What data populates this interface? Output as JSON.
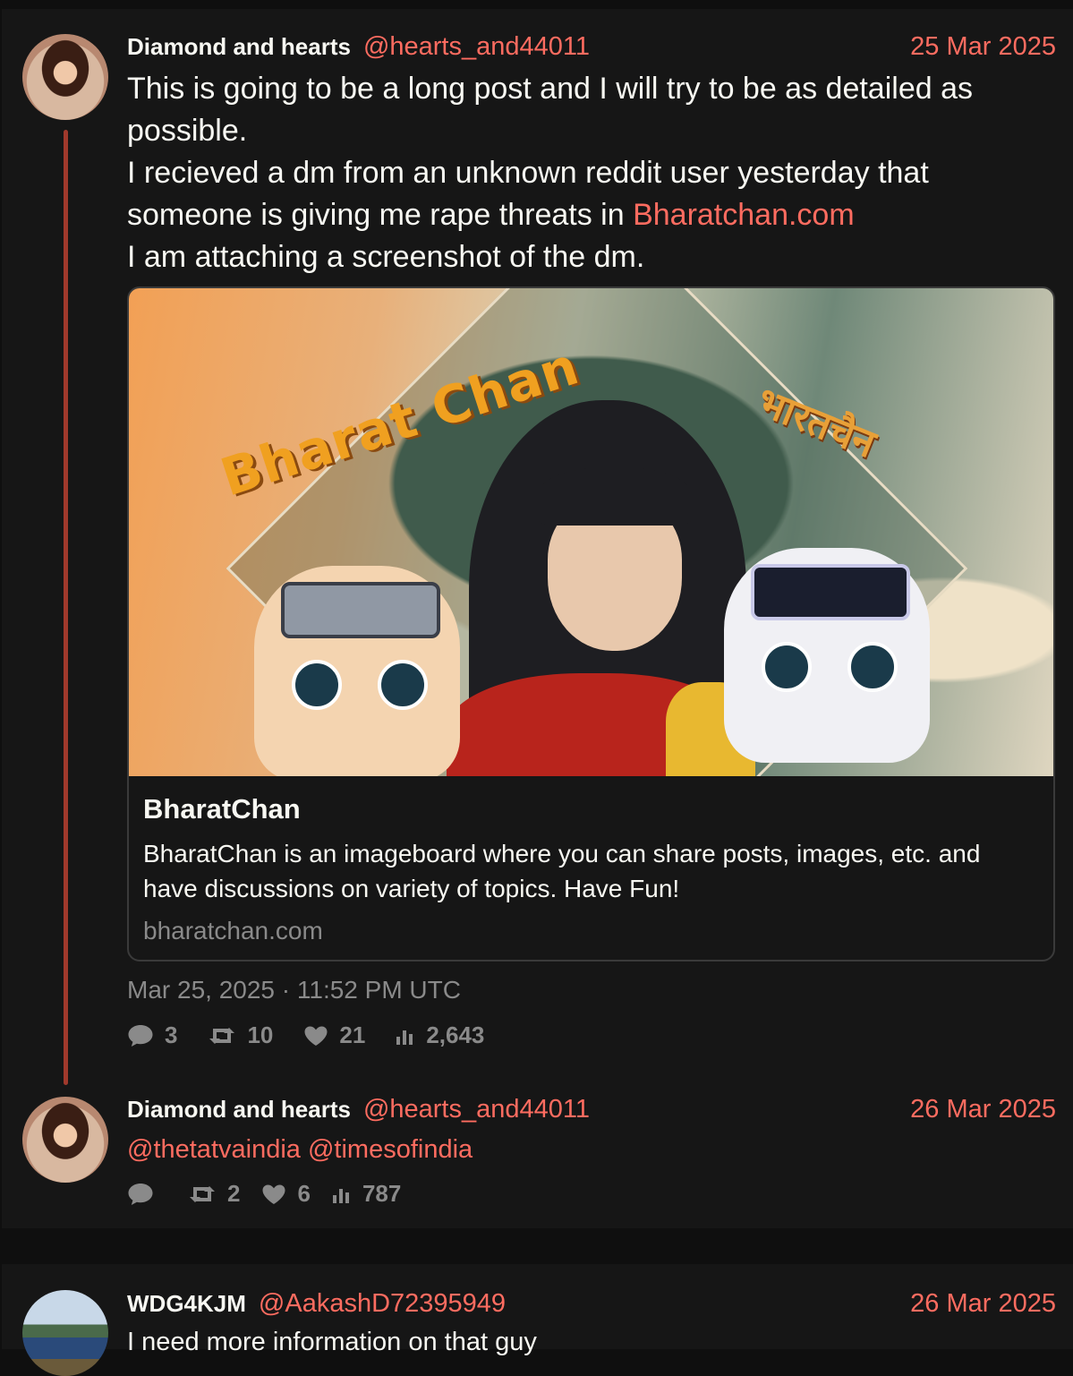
{
  "tweets": [
    {
      "name": "Diamond and hearts",
      "handle": "@hearts_and44011",
      "date": "25 Mar 2025",
      "lines": {
        "l1": "This is going to be a long post and I will try to be as detailed as possible.",
        "l2a": "I recieved a dm from an unknown reddit user yesterday that someone is giving me rape threats in ",
        "l2link": "Bharatchan.com",
        "l3": "I am attaching a screenshot of the dm."
      },
      "card": {
        "image_text_en": "Bharat Chan",
        "image_text_hi": "भारतचैन",
        "title": "BharatChan",
        "description": "BharatChan is an imageboard where you can share posts, images, etc. and have discussions on variety of topics. Have Fun!",
        "domain": "bharatchan.com"
      },
      "timestamp": "Mar 25, 2025 · 11:52 PM UTC",
      "stats": {
        "replies": "3",
        "retweets": "10",
        "likes": "21",
        "views": "2,643"
      }
    },
    {
      "name": "Diamond and hearts",
      "handle": "@hearts_and44011",
      "date": "26 Mar 2025",
      "mention1": "@thetatvaindia",
      "mention2": "@timesofindia",
      "stats": {
        "replies": "",
        "retweets": "2",
        "likes": "6",
        "views": "787"
      }
    },
    {
      "name": "WDG4KJM",
      "handle": "@AakashD72395949",
      "date": "26 Mar 2025",
      "text": "I need more information on that guy"
    }
  ],
  "colors": {
    "accent": "#ff6c60",
    "thread_line": "#a0392c",
    "muted": "#8a8a8a"
  },
  "icons": [
    "comment-icon",
    "retweet-icon",
    "heart-icon",
    "views-icon"
  ]
}
